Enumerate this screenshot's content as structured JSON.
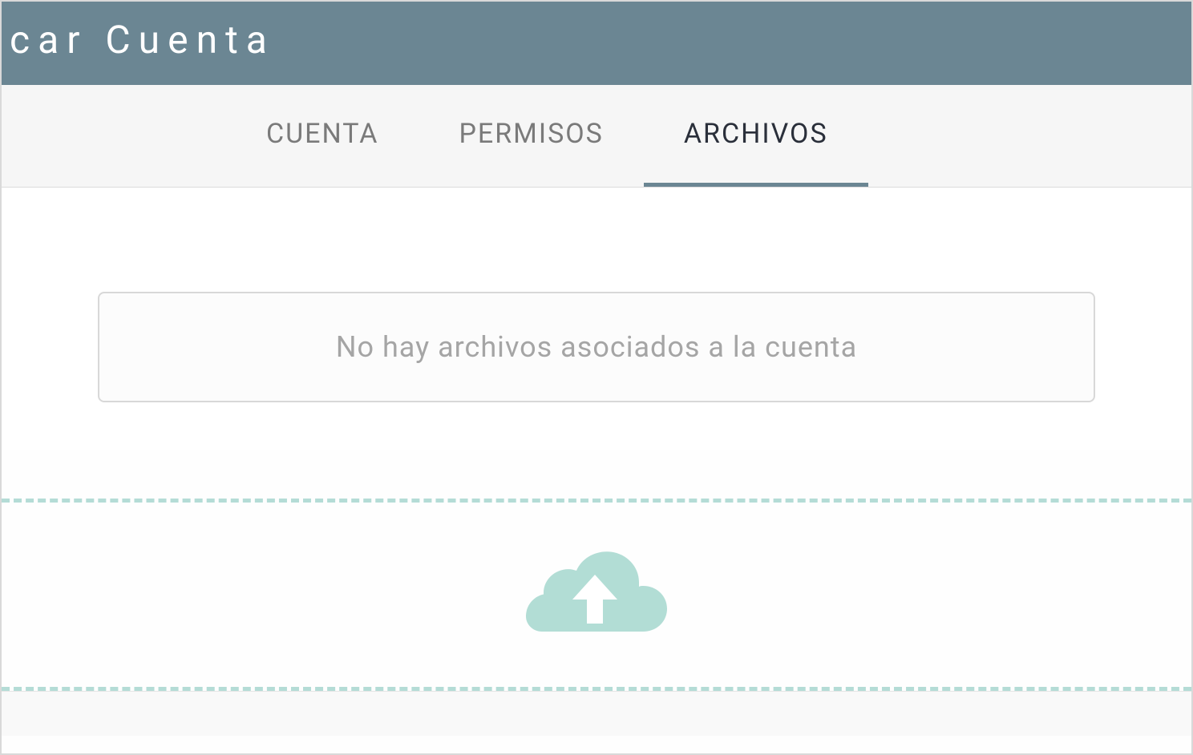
{
  "header": {
    "title": "car Cuenta"
  },
  "tabs": [
    {
      "label": "CUENTA",
      "active": false
    },
    {
      "label": "PERMISOS",
      "active": false
    },
    {
      "label": "ARCHIVOS",
      "active": true
    }
  ],
  "content": {
    "empty_message": "No hay archivos asociados a la cuenta"
  },
  "colors": {
    "header_bg": "#6b8693",
    "accent": "#b4dcd6",
    "cloud": "#b2ddd5"
  }
}
